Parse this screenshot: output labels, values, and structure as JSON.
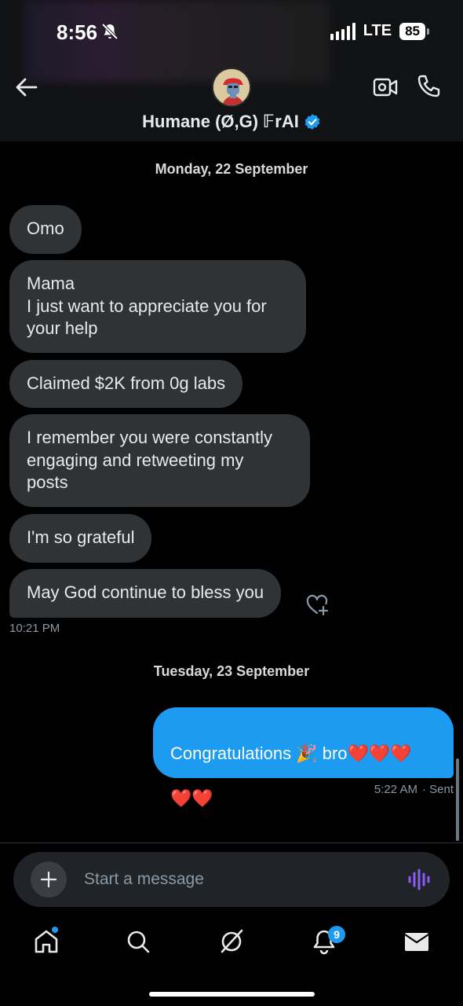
{
  "status_bar": {
    "time": "8:56",
    "network": "LTE",
    "battery": "85"
  },
  "header": {
    "chat_name": "Humane (Ø,G) 𝔽rAI",
    "icons": [
      "arrow-left-icon",
      "video-icon",
      "phone-icon",
      "verified-badge-icon"
    ]
  },
  "conversation": {
    "days": [
      {
        "label": "Monday, 22 September",
        "messages": [
          {
            "text": "Omo"
          },
          {
            "text": "Mama\nI just want to appreciate you for\nyour help"
          },
          {
            "text": "Claimed $2K from 0g labs"
          },
          {
            "text": "I remember you were constantly\nengaging and retweeting my\nposts"
          },
          {
            "text": "I'm so grateful"
          },
          {
            "text": "May God continue to bless you"
          }
        ],
        "last_time": "10:21 PM"
      },
      {
        "label": "Tuesday, 23 September",
        "sent_message": {
          "line1": "Congratulations 🎉 bro❤️❤️❤️",
          "line2": "❤️❤️"
        },
        "sent_time": "5:22 AM",
        "sent_status": "· Sent"
      }
    ]
  },
  "composer": {
    "placeholder": "Start a message"
  },
  "bottom_nav": {
    "items": [
      "home-icon",
      "search-icon",
      "grok-icon",
      "notifications-icon",
      "messages-icon"
    ],
    "notifications_count": "9"
  },
  "colors": {
    "accent": "#1d9bf0",
    "bubble_received": "#2f3336",
    "background": "#000000"
  }
}
